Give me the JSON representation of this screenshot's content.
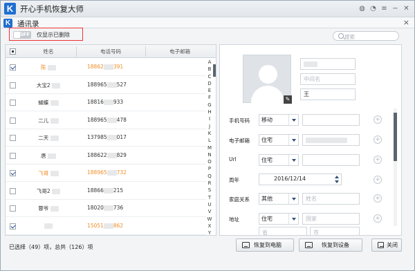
{
  "app": {
    "title": "开心手机恢复大师",
    "logo_letter": "K"
  },
  "window_controls": [
    {
      "name": "wechat-icon",
      "glyph": "◍"
    },
    {
      "name": "chat-icon",
      "glyph": "◔"
    },
    {
      "name": "menu-icon",
      "glyph": "≡"
    },
    {
      "name": "minimize-icon",
      "glyph": "−"
    },
    {
      "name": "close-icon",
      "glyph": "✕"
    }
  ],
  "section": {
    "title": "通讯录",
    "logo_letter": "K",
    "close_glyph": "×"
  },
  "filter": {
    "toggle_state": "OFF",
    "label": "仅显示已删除"
  },
  "search": {
    "placeholder": "搜索"
  },
  "table": {
    "headers": {
      "name": "姓名",
      "phone": "电话号码",
      "email": "电子邮箱"
    },
    "rows": [
      {
        "name": "陈",
        "phone": "18862",
        "phone_tail": "391",
        "checked": true,
        "deleted": true
      },
      {
        "name": "大宝2",
        "phone": "188965",
        "phone_tail": "527",
        "checked": false,
        "deleted": false
      },
      {
        "name": "蝴蝶",
        "phone": "18816",
        "phone_tail": "933",
        "checked": false,
        "deleted": false
      },
      {
        "name": "二儿",
        "phone": "188965",
        "phone_tail": "478",
        "checked": false,
        "deleted": false
      },
      {
        "name": "二天",
        "phone": "137985",
        "phone_tail": "017",
        "checked": false,
        "deleted": false
      },
      {
        "name": "唐",
        "phone": "188622",
        "phone_tail": "829",
        "checked": false,
        "deleted": false
      },
      {
        "name": "飞哥",
        "phone": "188965",
        "phone_tail": "732",
        "checked": true,
        "deleted": true
      },
      {
        "name": "飞哥2",
        "phone": "18866",
        "phone_tail": "215",
        "checked": false,
        "deleted": false
      },
      {
        "name": "蓉爷",
        "phone": "18020",
        "phone_tail": "736",
        "checked": false,
        "deleted": false
      },
      {
        "name": "",
        "phone": "15051",
        "phone_tail": "862",
        "checked": true,
        "deleted": true
      }
    ],
    "alphabet": [
      "A",
      "B",
      "C",
      "D",
      "E",
      "F",
      "G",
      "H",
      "I",
      "J",
      "K",
      "L",
      "M",
      "N",
      "O",
      "P",
      "Q",
      "R",
      "S",
      "T",
      "U",
      "V",
      "W",
      "X",
      "Y",
      "Z"
    ]
  },
  "detail": {
    "middle_name_placeholder": "中间名",
    "last_name": "王",
    "fields": {
      "phone": {
        "label": "手机号码",
        "type": "移动"
      },
      "email": {
        "label": "电子邮箱",
        "type": "住宅"
      },
      "url": {
        "label": "Url",
        "type": "住宅"
      },
      "anniversary": {
        "label": "周年",
        "value": "2016/12/14"
      },
      "relation": {
        "label": "家庭关系",
        "type": "其他",
        "placeholder": "姓名"
      },
      "address": {
        "label": "地址",
        "type": "住宅",
        "country_placeholder": "国家",
        "province_placeholder": "省",
        "city_placeholder": "市"
      }
    },
    "plus_glyph": "+"
  },
  "footer": {
    "status": "已选择（49）项，总共（126）项",
    "restore_pc": "恢复到电脑",
    "restore_device": "恢复到设备",
    "close": "关闭"
  }
}
